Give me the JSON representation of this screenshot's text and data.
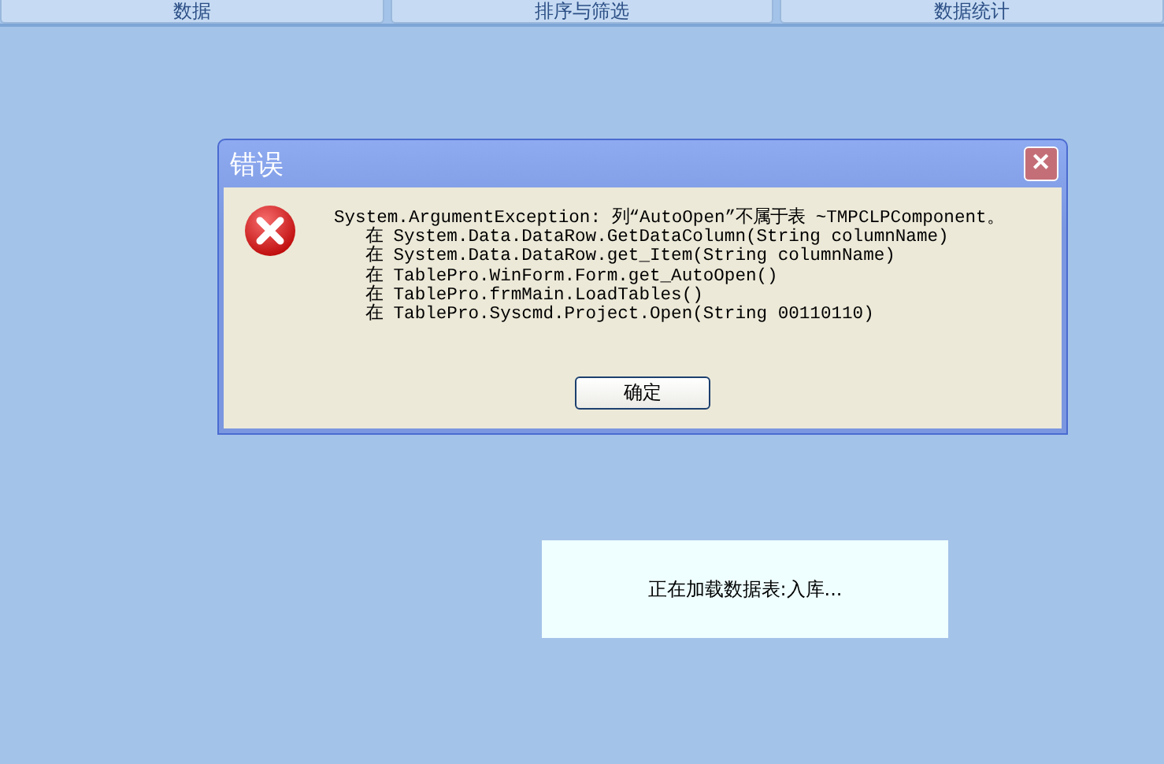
{
  "tabs": [
    {
      "label": "数据",
      "selected": false
    },
    {
      "label": "排序与筛选",
      "selected": false
    },
    {
      "label": "数据统计",
      "selected": false
    }
  ],
  "dialog": {
    "title": "错误",
    "close": "✕",
    "message": "System.ArgumentException: 列“AutoOpen”不属于表 ~TMPCLPComponent。",
    "stack": [
      "在 System.Data.DataRow.GetDataColumn(String columnName)",
      "在 System.Data.DataRow.get_Item(String columnName)",
      "在 TablePro.WinForm.Form.get_AutoOpen()",
      "在 TablePro.frmMain.LoadTables()",
      "在 TablePro.Syscmd.Project.Open(String 00110110)"
    ],
    "button": "确定"
  },
  "loading": {
    "text": "正在加载数据表:入库..."
  }
}
